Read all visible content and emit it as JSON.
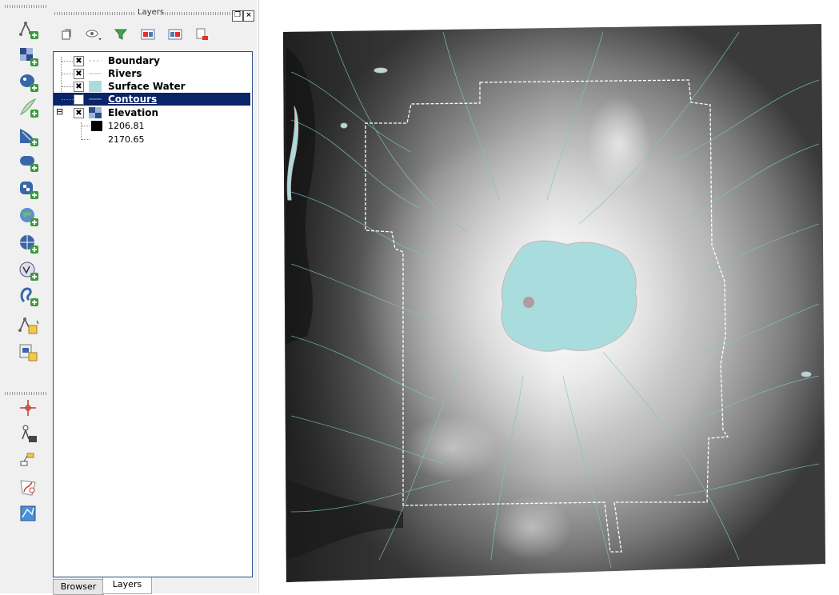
{
  "toolbar": {
    "tools": [
      {
        "icon": "new-vector-layer-icon"
      },
      {
        "icon": "add-raster-layer-icon"
      },
      {
        "icon": "add-postgis-layer-icon"
      },
      {
        "icon": "add-spatialite-layer-icon"
      },
      {
        "icon": "add-mssql-layer-icon"
      },
      {
        "icon": "add-oracle-layer-icon"
      },
      {
        "icon": "add-wms-layer-icon"
      },
      {
        "icon": "add-wcs-layer-icon"
      },
      {
        "icon": "add-wfs-layer-icon"
      },
      {
        "icon": "add-delimited-text-layer-icon"
      },
      {
        "icon": "add-gpx-layer-icon"
      },
      {
        "icon": "new-shapefile-layer-icon"
      },
      {
        "icon": "new-spatialite-layer-icon"
      },
      {
        "icon": "georeferencer-icon"
      },
      {
        "icon": "measure-tool-icon"
      },
      {
        "icon": "node-tool-icon"
      },
      {
        "icon": "digitize-icon"
      },
      {
        "icon": "add-feature-icon"
      }
    ]
  },
  "panel": {
    "title": "Layers",
    "close_symbol": "×",
    "float_symbol": "❐"
  },
  "layers": [
    {
      "name": "Boundary",
      "checked": true,
      "checkmark": "✖",
      "symbol": "line-dashed"
    },
    {
      "name": "Rivers",
      "checked": true,
      "checkmark": "✖",
      "symbol": "line"
    },
    {
      "name": "Surface Water",
      "checked": true,
      "checkmark": "✖",
      "symbol": "fill",
      "color": "#a9dcdc"
    },
    {
      "name": "Contours",
      "checked": false,
      "checkmark": "",
      "symbol": "line",
      "selected": true
    },
    {
      "name": "Elevation",
      "checked": true,
      "checkmark": "✖",
      "symbol": "raster",
      "expanded": true,
      "expand_symbol": "⊟",
      "legend": [
        {
          "value": "1206.81",
          "color": "#000000"
        },
        {
          "value": "2170.65",
          "color": "#ffffff"
        }
      ]
    }
  ],
  "tabs": [
    {
      "label": "Browser",
      "active": false
    },
    {
      "label": "Layers",
      "active": true
    }
  ],
  "colors": {
    "selection": "#0a246a",
    "water": "#a9dcdc",
    "rivers": "#7fc4c4",
    "boundary": "#ffffff"
  }
}
